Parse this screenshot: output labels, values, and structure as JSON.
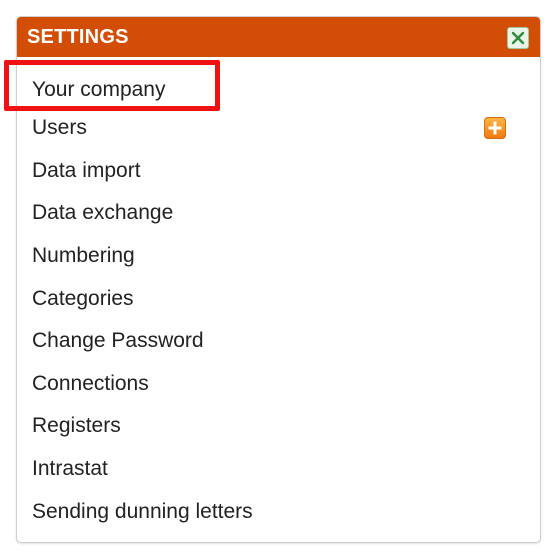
{
  "panel": {
    "title": "SETTINGS",
    "header_color": "#d24e06",
    "close_icon": "close-x-icon",
    "highlight_color": "#ee1212"
  },
  "menu": {
    "items": [
      {
        "label": "Your company",
        "highlighted": true
      },
      {
        "label": "Users",
        "action_icon": "plus-icon"
      },
      {
        "label": "Data import"
      },
      {
        "label": "Data exchange"
      },
      {
        "label": "Numbering"
      },
      {
        "label": "Categories"
      },
      {
        "label": "Change Password"
      },
      {
        "label": "Connections"
      },
      {
        "label": "Registers"
      },
      {
        "label": "Intrastat"
      },
      {
        "label": "Sending dunning letters"
      }
    ]
  }
}
